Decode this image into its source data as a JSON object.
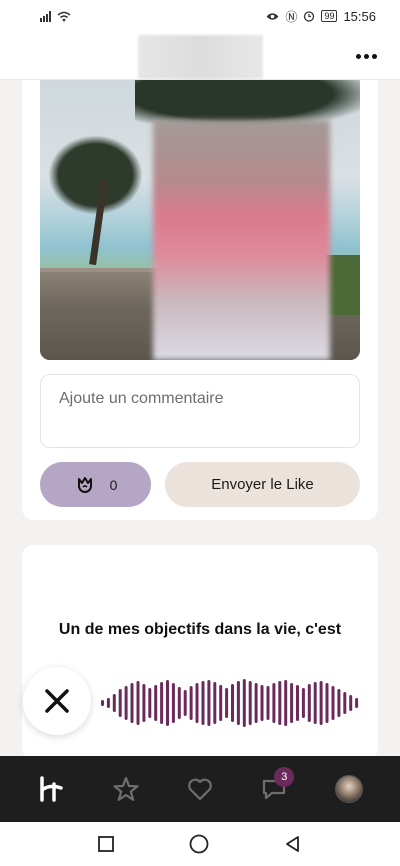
{
  "status_bar": {
    "time": "15:56",
    "battery_level": "99",
    "icons": [
      "signal-icon",
      "wifi-icon",
      "eye-icon",
      "nfc-icon",
      "alarm-icon"
    ]
  },
  "header": {
    "title_redacted": true,
    "more_icon": "more-dots-icon"
  },
  "photo_card": {
    "comment_placeholder": "Ajoute un commentaire",
    "rose_count": "0",
    "like_label": "Envoyer le Like"
  },
  "prompt_card": {
    "prompt": "Un de mes objectifs dans la vie, c'est",
    "waveform_color": "#6b2a5c"
  },
  "bottom_nav": {
    "items": [
      {
        "icon": "hinge-logo-icon"
      },
      {
        "icon": "star-icon"
      },
      {
        "icon": "heart-icon"
      },
      {
        "icon": "chat-icon",
        "badge": "3"
      },
      {
        "icon": "avatar"
      }
    ],
    "badge_color": "#6b2a5c"
  },
  "colors": {
    "rose_button_bg": "#b6a6c6",
    "like_button_bg": "#ece2dc",
    "nav_bg": "#1e1e1e"
  }
}
